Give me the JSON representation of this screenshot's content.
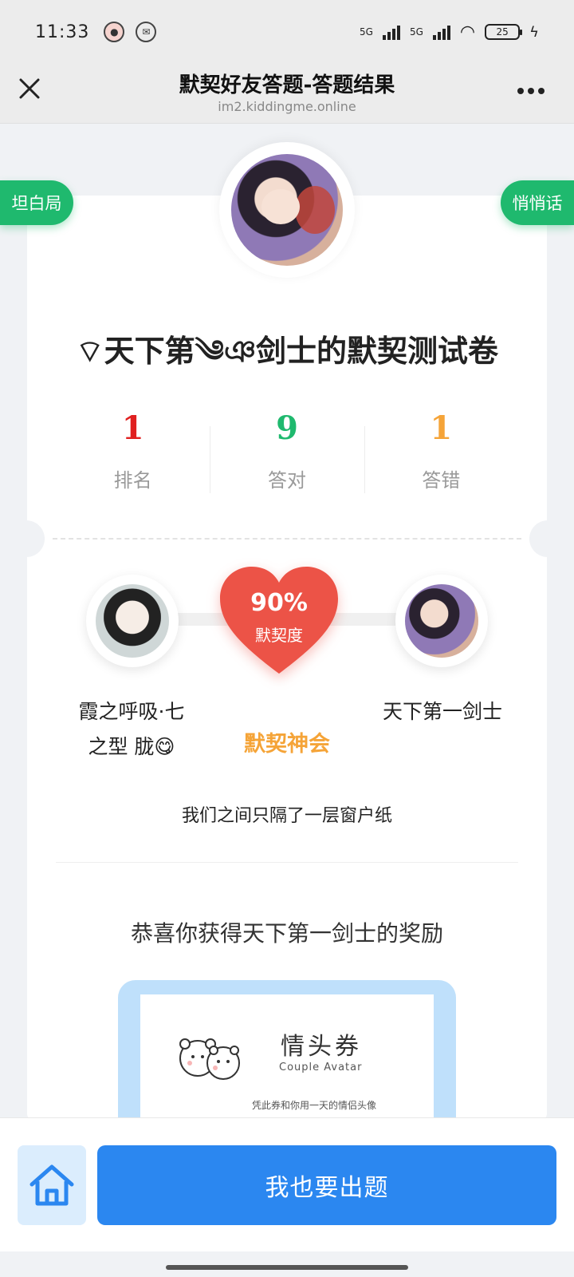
{
  "status": {
    "time": "11:33",
    "signal1": "5G",
    "signal2": "5G",
    "battery": "25"
  },
  "nav": {
    "title": "默契好友答题-答题结果",
    "subtitle": "im2.kiddingme.online",
    "close_icon": "close-icon",
    "more_icon": "more-icon"
  },
  "tabs": {
    "left": "坦白局",
    "right": "悄悄话"
  },
  "quiz": {
    "title": "⌔天下第༄ঞ剑士的默契测试卷"
  },
  "stats": [
    {
      "value": "1",
      "label": "排名",
      "color": "#e02020"
    },
    {
      "value": "9",
      "label": "答对",
      "color": "#1fb96e"
    },
    {
      "value": "1",
      "label": "答错",
      "color": "#f5a438"
    }
  ],
  "match": {
    "percent": "90%",
    "percent_label": "默契度",
    "level": "默契神会",
    "description": "我们之间只隔了一层窗户纸",
    "left_name": "霞之呼吸·七之型 胧😋",
    "right_name": "天下第一剑士"
  },
  "reward": {
    "title": "恭喜你获得天下第一剑士的奖励",
    "coupon_title": "情头券",
    "coupon_en": "Couple Avatar",
    "coupon_note": "凭此券和你用一天的情侣头像"
  },
  "bottom": {
    "home_icon": "home-icon",
    "create_label": "我也要出题"
  },
  "colors": {
    "accent_green": "#1fb96e",
    "accent_blue": "#2b87f0",
    "heart_red": "#ec5347",
    "gold": "#f5a438"
  }
}
